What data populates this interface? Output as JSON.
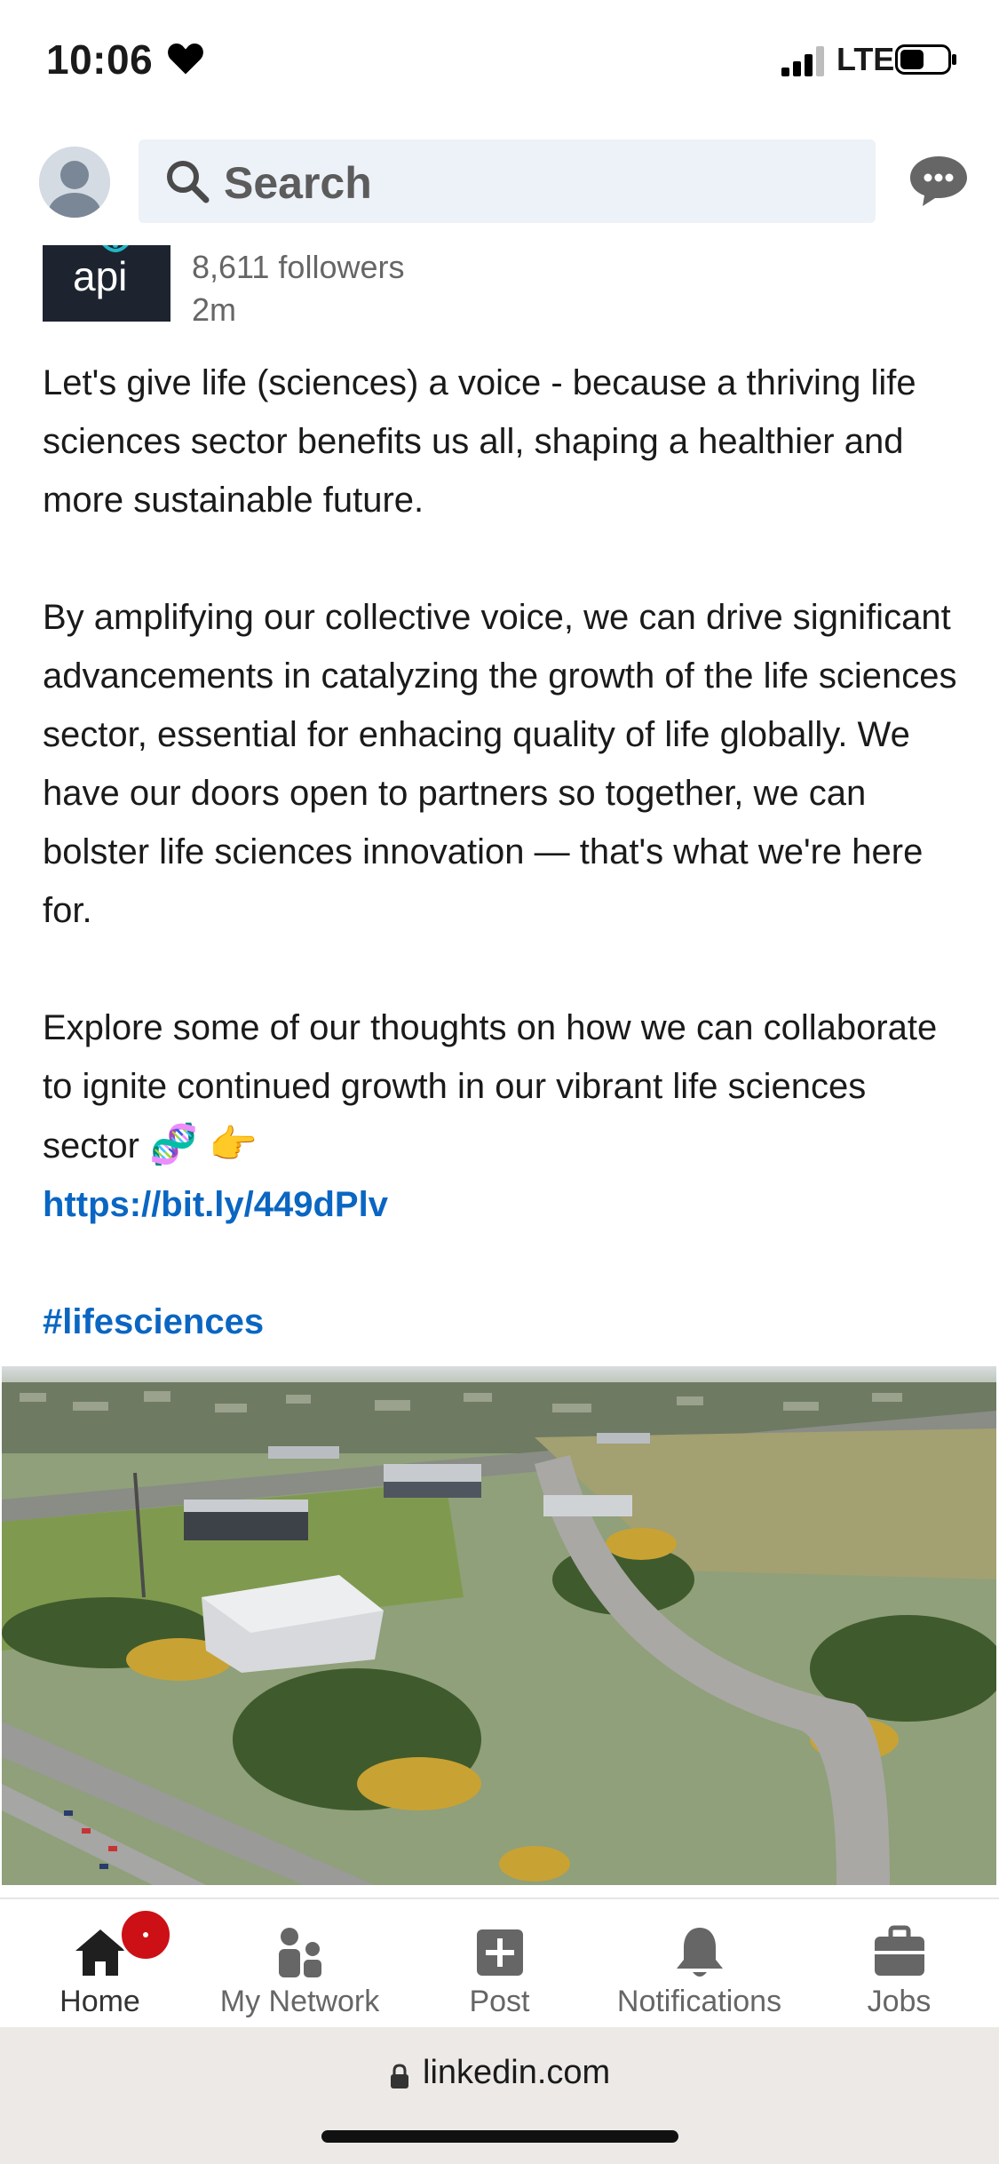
{
  "status_bar": {
    "time": "10:06",
    "network": "LTE",
    "icons": [
      "heart-icon",
      "signal-icon",
      "battery-icon"
    ]
  },
  "header": {
    "search_placeholder": "Search",
    "icons": [
      "avatar",
      "search-icon",
      "messaging-icon"
    ]
  },
  "post": {
    "company_logo_text": "api",
    "followers": "8,611 followers",
    "time_ago": "2m",
    "paragraph_1": "Let's give life (sciences) a voice - because a thriving life sciences sector benefits us all, shaping a healthier and more sustainable future.",
    "paragraph_2": "By amplifying our collective voice, we can drive significant advancements in catalyzing the growth of the life sciences sector, essential for enhacing quality of life globally. We have our doors open to partners so together, we can bolster life sciences innovation — that's what we're here for.",
    "paragraph_3": "Explore some of our thoughts on how we can collaborate to ignite continued growth in our vibrant life sciences sector",
    "paragraph_3_emojis": "🧬 👉",
    "link": "https://bit.ly/449dPlv",
    "hashtag": "#lifesciences",
    "image_description_icon": "aerial-campus-photo"
  },
  "bottom_nav": {
    "items": [
      {
        "label": "Home",
        "icon": "home-icon",
        "active": true,
        "badge": true
      },
      {
        "label": "My Network",
        "icon": "network-icon",
        "active": false
      },
      {
        "label": "Post",
        "icon": "post-icon",
        "active": false
      },
      {
        "label": "Notifications",
        "icon": "bell-icon",
        "active": false
      },
      {
        "label": "Jobs",
        "icon": "briefcase-icon",
        "active": false
      }
    ]
  },
  "browser": {
    "url": "linkedin.com"
  },
  "colors": {
    "link": "#0a66c2",
    "badge": "#cc1016",
    "search_bg": "#edf2f8"
  }
}
